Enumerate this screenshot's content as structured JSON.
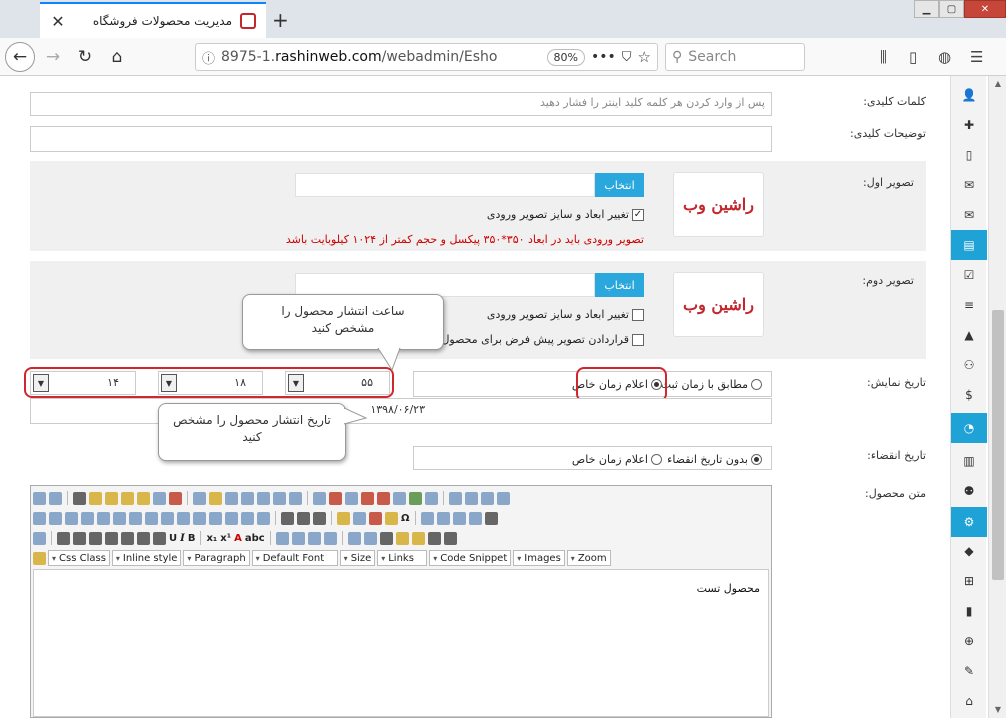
{
  "browser": {
    "tab_title": "مدیریت محصولات فروشگاه",
    "url_prefix": "8975-1.",
    "url_domain": "rashinweb.com",
    "url_path": "/webadmin/Esho",
    "zoom": "80%",
    "search_placeholder": "Search"
  },
  "form": {
    "keywords_label": "کلمات کلیدی:",
    "keywords_placeholder": "پس از وارد کردن هر کلمه کلید اینتر را فشار دهید",
    "keyword_desc_label": "توضیحات کلیدی:",
    "image1": {
      "label": "تصویر اول:",
      "choose_label": "انتخاب",
      "resize_label": "تغییر ابعاد و سایز تصویر ورودی",
      "resize_checked": true,
      "warning": "تصویر ورودی باید در ابعاد ۳۵۰*۳۵۰ پیکسل و حجم کمتر از ۱۰۲۴ کیلوبایت باشد"
    },
    "image2": {
      "label": "تصویر دوم:",
      "choose_label": "انتخاب",
      "resize_label": "تغییر ابعاد و سایز تصویر ورودی",
      "resize_checked": false,
      "default_label": "قراردادن تصویر پیش فرض برای محصول",
      "default_checked": false
    },
    "logo_text": "راشین وب",
    "display_date": {
      "label": "تاریخ نمایش:",
      "option_fixed": "مطابق با زمان ثبت",
      "option_custom": "اعلام زمان خاص",
      "selected": "custom",
      "minute": "۵۵",
      "hour": "۱۸",
      "second": "۱۴",
      "date": "۱۳۹۸/۰۶/۲۳"
    },
    "expire_date": {
      "label": "تاریخ انقضاء:",
      "option_none": "بدون تاریخ انقضاء",
      "option_custom": "اعلام زمان خاص",
      "selected": "none"
    },
    "body_label": "متن محصول:",
    "body_text": "محصول تست"
  },
  "callouts": {
    "time": "ساعت انتشار محصول را مشخص کنید",
    "date": "تاریخ انتشار محصول را مشخص کنید"
  },
  "editor": {
    "dropdowns": [
      "Css Class",
      "Inline style",
      "Paragraph",
      "Default Font",
      "Size",
      "Links",
      "Code Snippet",
      "Images",
      "Zoom"
    ],
    "bold": "B",
    "italic": "I",
    "underline": "U",
    "font_color": "A",
    "spell": "abc",
    "sub": "x₁",
    "sup": "x¹",
    "omega": "Ω"
  },
  "sidebar_icons": [
    "user-icon",
    "user-plus-icon",
    "mobile-icon",
    "comments-icon",
    "envelope-icon",
    "folder-open-icon",
    "check-square-icon",
    "list-icon",
    "road-icon",
    "users-icon",
    "dollar-icon",
    "pie-chart-icon",
    "bar-chart-icon",
    "sitemap-icon",
    "cog-icon",
    "tags-icon",
    "windows-icon",
    "file-icon",
    "search-plus-icon",
    "wrench-icon",
    "home-icon"
  ],
  "colors": {
    "accent": "#1fa2d6",
    "choose_button": "#2aa7dd",
    "highlight_red": "#d1262e",
    "warning_text": "#cc0000"
  }
}
